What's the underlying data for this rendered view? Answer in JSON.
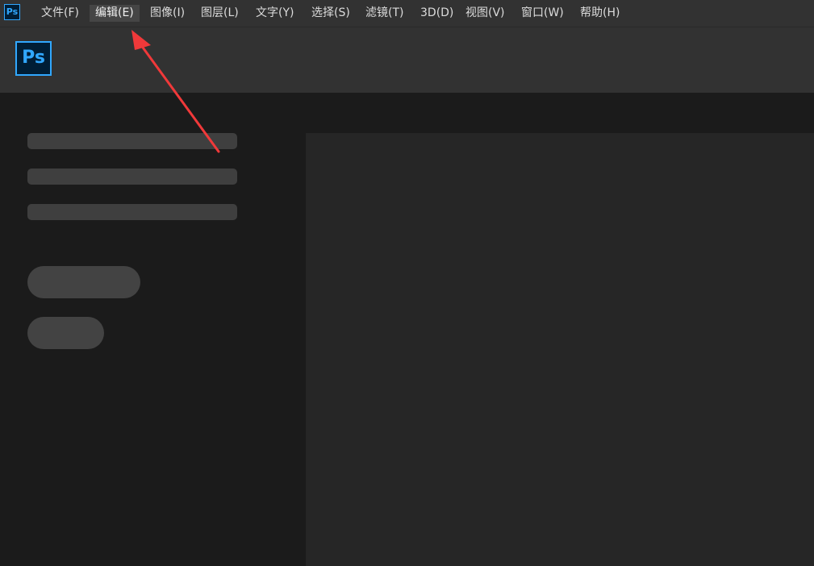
{
  "menubar": {
    "app_icon": "Ps",
    "items": [
      {
        "label": "文件(F)"
      },
      {
        "label": "编辑(E)"
      },
      {
        "label": "图像(I)"
      },
      {
        "label": "图层(L)"
      },
      {
        "label": "文字(Y)"
      },
      {
        "label": "选择(S)"
      },
      {
        "label": "滤镜(T)"
      },
      {
        "label": "3D(D)"
      },
      {
        "label": "视图(V)"
      },
      {
        "label": "窗口(W)"
      },
      {
        "label": "帮助(H)"
      }
    ],
    "active_item": "编辑(E)"
  },
  "header": {
    "logo_text": "Ps"
  },
  "colors": {
    "brand_blue": "#31a8ff",
    "brand_dark": "#001e36",
    "annotation_red": "#f0393a"
  },
  "annotation": {
    "icon": "red-arrow-icon",
    "points_to": "编辑(E)"
  }
}
